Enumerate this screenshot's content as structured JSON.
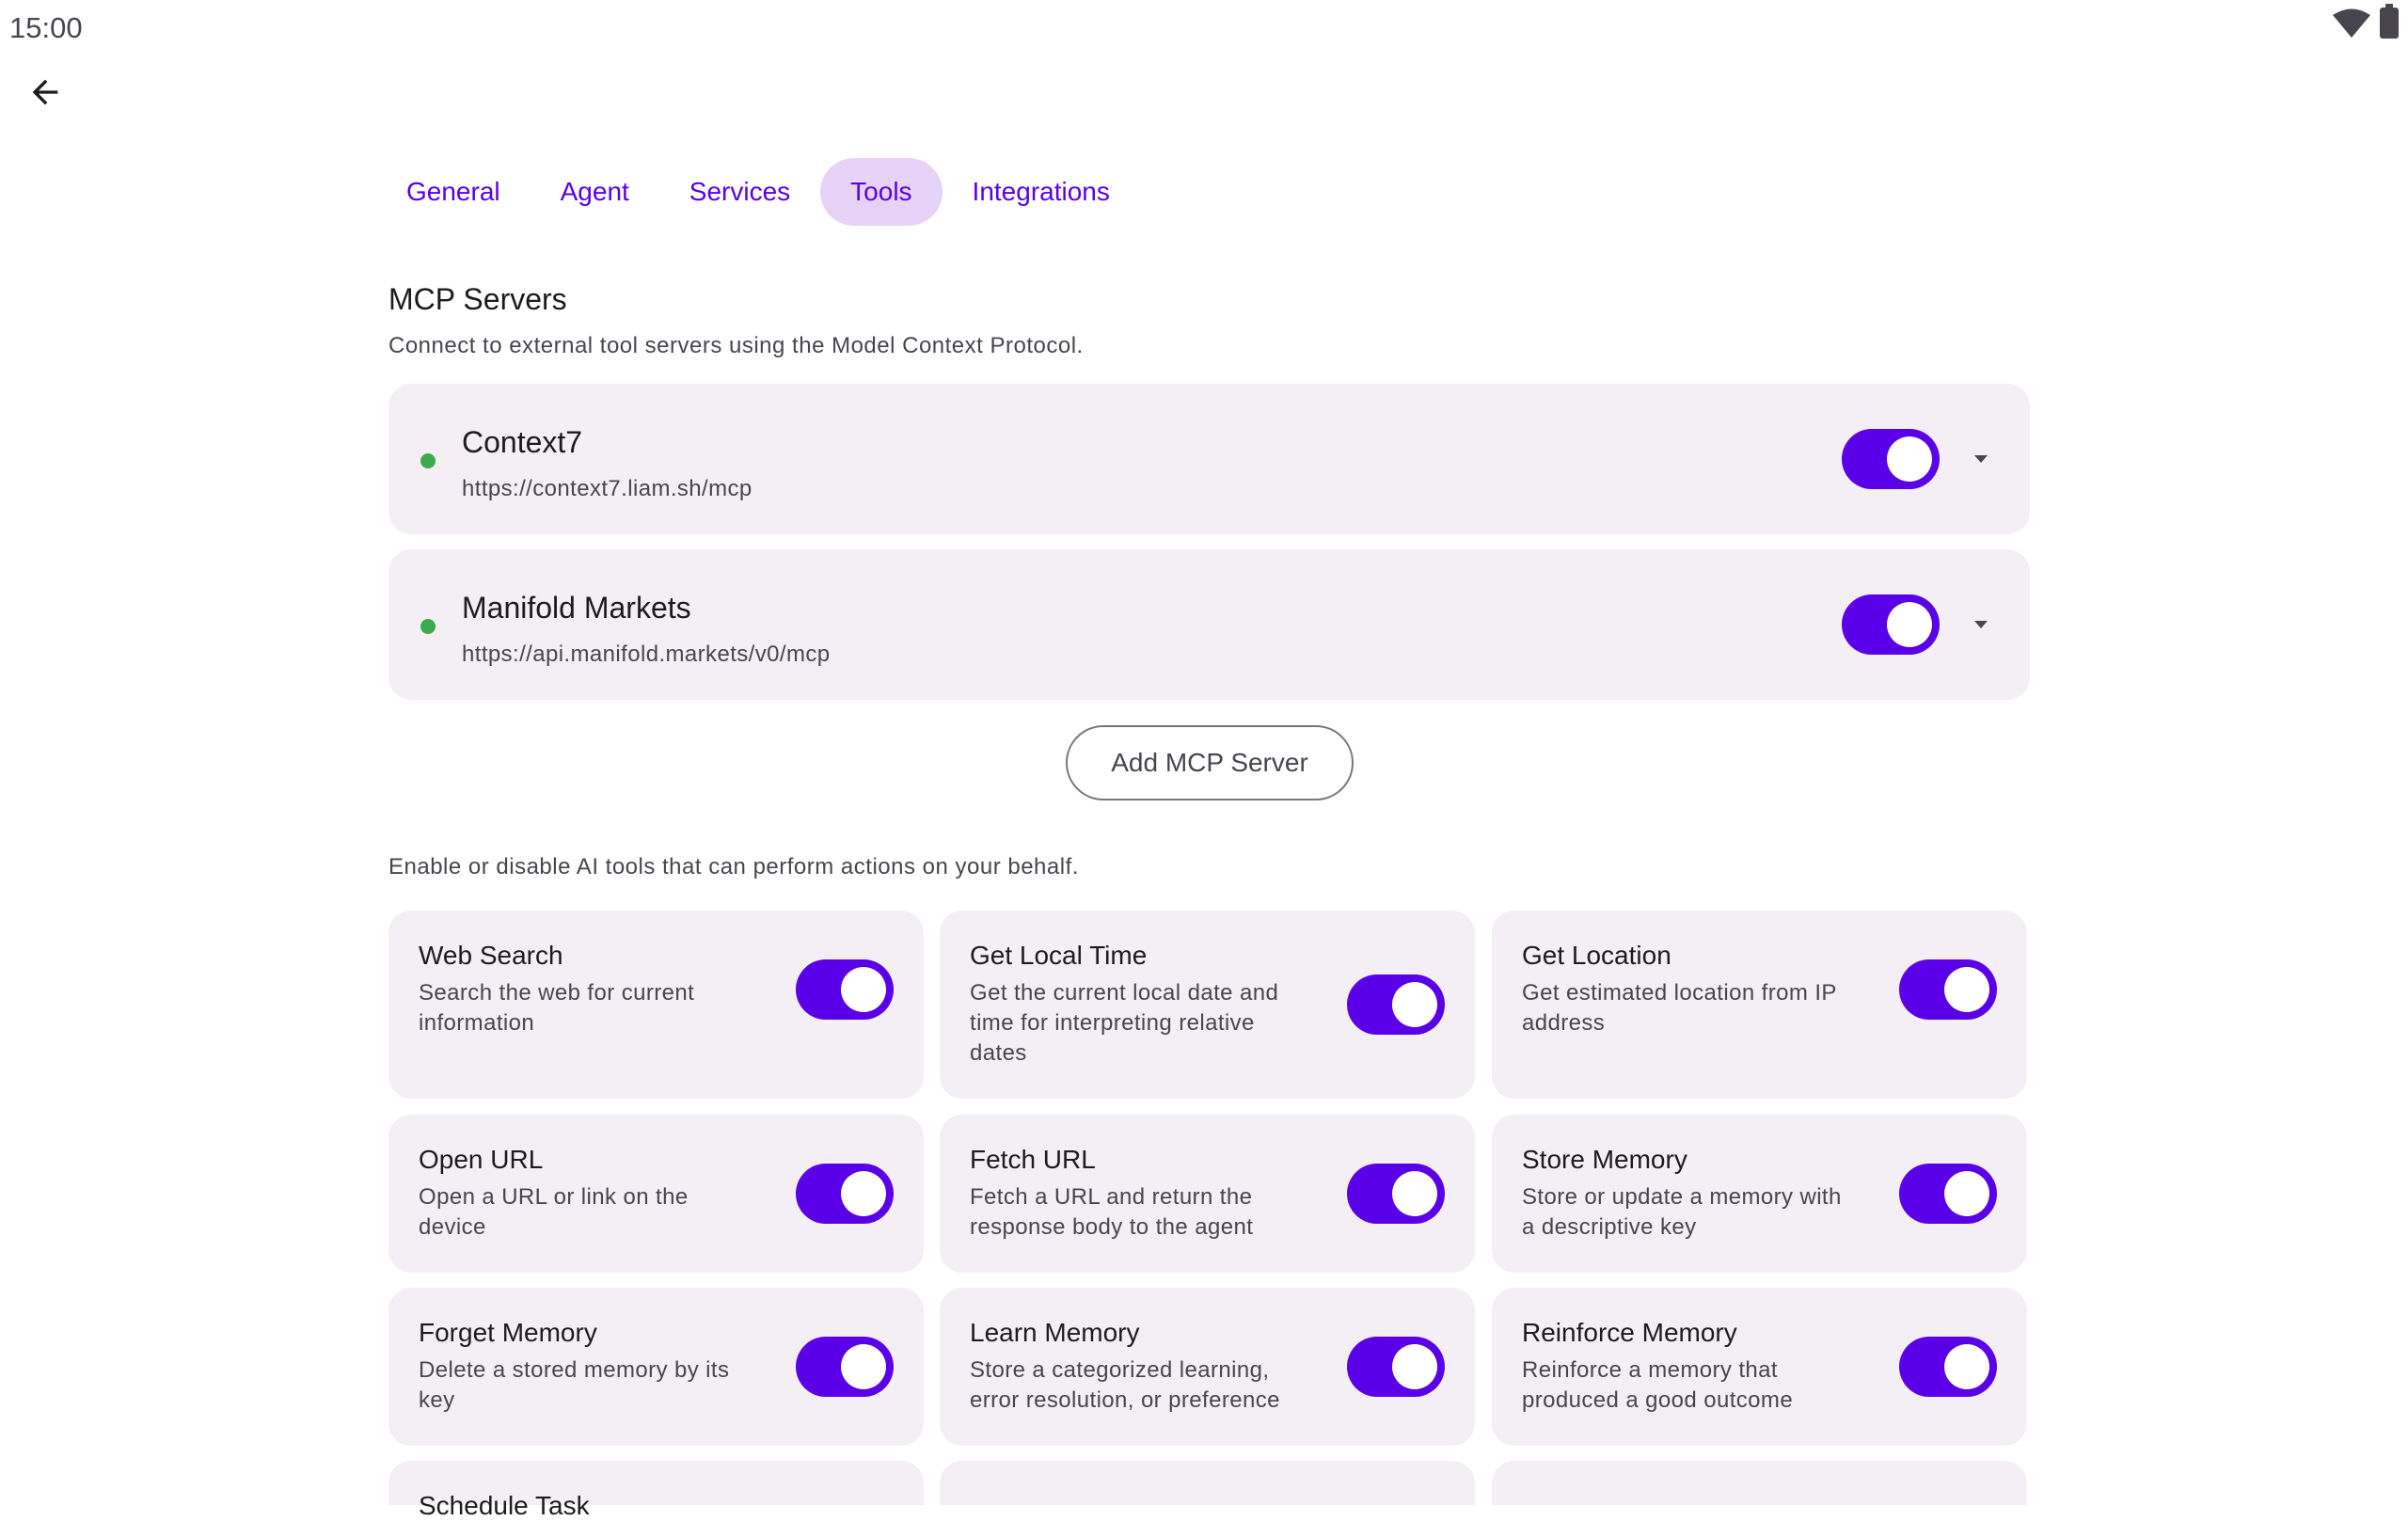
{
  "status": {
    "time": "15:00"
  },
  "tabs": [
    {
      "label": "General",
      "active": false
    },
    {
      "label": "Agent",
      "active": false
    },
    {
      "label": "Services",
      "active": false
    },
    {
      "label": "Tools",
      "active": true
    },
    {
      "label": "Integrations",
      "active": false
    }
  ],
  "mcp": {
    "title": "MCP Servers",
    "description": "Connect to external tool servers using the Model Context Protocol.",
    "servers": [
      {
        "name": "Context7",
        "url": "https://context7.liam.sh/mcp",
        "enabled": true,
        "status_color": "#3dab4a"
      },
      {
        "name": "Manifold Markets",
        "url": "https://api.manifold.markets/v0/mcp",
        "enabled": true,
        "status_color": "#3dab4a"
      }
    ],
    "add_label": "Add MCP Server"
  },
  "tools": {
    "description": "Enable or disable AI tools that can perform actions on your behalf.",
    "items": [
      {
        "title": "Web Search",
        "desc": "Search the web for current information",
        "enabled": true
      },
      {
        "title": "Get Local Time",
        "desc": "Get the current local date and time for interpreting relative dates",
        "enabled": true
      },
      {
        "title": "Get Location",
        "desc": "Get estimated location from IP address",
        "enabled": true
      },
      {
        "title": "Open URL",
        "desc": "Open a URL or link on the device",
        "enabled": true
      },
      {
        "title": "Fetch URL",
        "desc": "Fetch a URL and return the response body to the agent",
        "enabled": true
      },
      {
        "title": "Store Memory",
        "desc": "Store or update a memory with a descriptive key",
        "enabled": true
      },
      {
        "title": "Forget Memory",
        "desc": "Delete a stored memory by its key",
        "enabled": true
      },
      {
        "title": "Learn Memory",
        "desc": "Store a categorized learning, error resolution, or preference",
        "enabled": true
      },
      {
        "title": "Reinforce Memory",
        "desc": "Reinforce a memory that produced a good outcome",
        "enabled": true
      },
      {
        "title": "Schedule Task",
        "desc": "",
        "enabled": true
      },
      {
        "title": "",
        "desc": "",
        "enabled": true
      },
      {
        "title": "",
        "desc": "",
        "enabled": true
      }
    ]
  },
  "colors": {
    "accent": "#5a00e8",
    "card_bg": "#f3eff5",
    "active_tab_bg": "#e6d3f7",
    "status_ok": "#3dab4a"
  }
}
